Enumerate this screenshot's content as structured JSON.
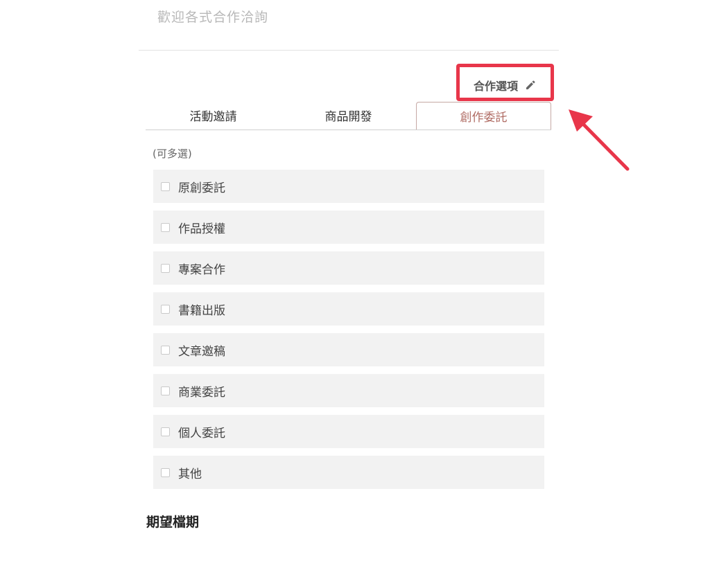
{
  "form": {
    "message_placeholder": "歡迎各式合作洽詢"
  },
  "section": {
    "title": "合作選項",
    "edit_icon": "pencil-icon"
  },
  "tabs": [
    {
      "label": "活動邀請",
      "active": false
    },
    {
      "label": "商品開發",
      "active": false
    },
    {
      "label": "創作委託",
      "active": true
    }
  ],
  "options": {
    "hint": "(可多選)",
    "items": [
      {
        "label": "原創委託",
        "checked": false
      },
      {
        "label": "作品授權",
        "checked": false
      },
      {
        "label": "專案合作",
        "checked": false
      },
      {
        "label": "書籍出版",
        "checked": false
      },
      {
        "label": "文章邀稿",
        "checked": false
      },
      {
        "label": "商業委託",
        "checked": false
      },
      {
        "label": "個人委託",
        "checked": false
      },
      {
        "label": "其他",
        "checked": false
      }
    ]
  },
  "next_section": {
    "title": "期望檔期"
  },
  "colors": {
    "highlight": "#e8364a",
    "active_tab": "#b06c64",
    "option_bg": "#f2f2f2"
  }
}
